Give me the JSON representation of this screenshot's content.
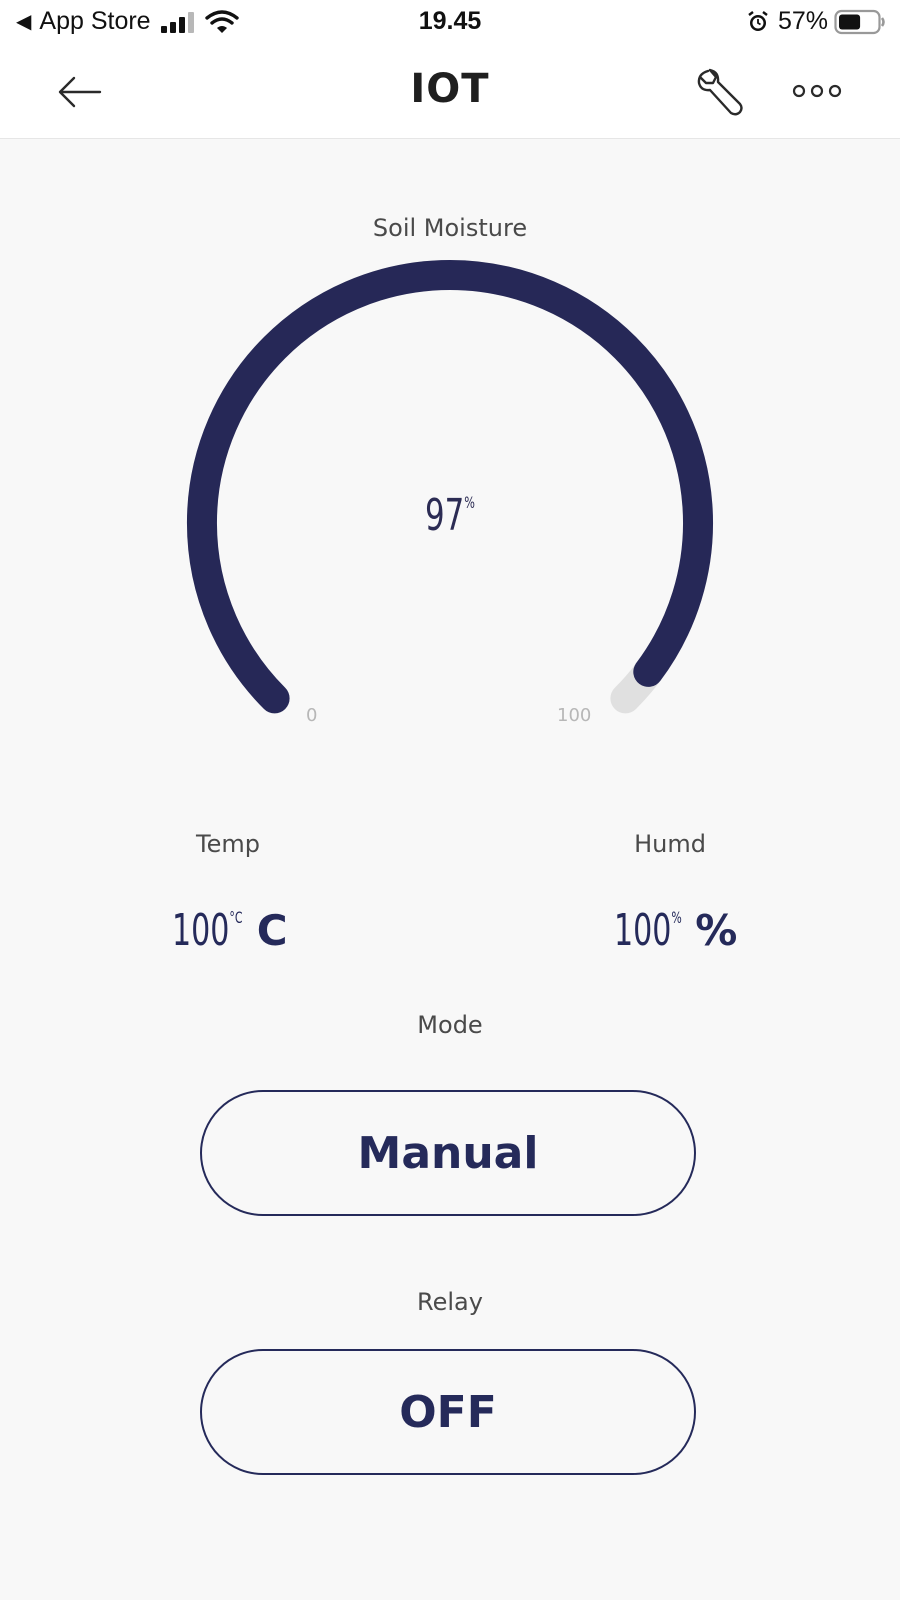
{
  "status_bar": {
    "back_app": "App Store",
    "time": "19.45",
    "battery_percent": "57%",
    "battery_level": 0.57,
    "signal_bars": 3
  },
  "nav": {
    "title": "IOT",
    "back_icon": "arrow-left-icon",
    "settings_icon": "wrench-icon",
    "more_icon": "more-dots-icon"
  },
  "gauge": {
    "label": "Soil Moisture",
    "value": "97",
    "value_unit": "%",
    "value_num": 97,
    "min": "0",
    "max": "100",
    "min_num": 0,
    "max_num": 100,
    "fill_color": "#262857",
    "track_color": "#e0e0e0"
  },
  "temp": {
    "label": "Temp",
    "value": "100",
    "value_unit": "°C",
    "unit": "C"
  },
  "humd": {
    "label": "Humd",
    "value": "100",
    "value_unit": "%",
    "unit": "%"
  },
  "mode": {
    "label": "Mode",
    "button": "Manual"
  },
  "relay": {
    "label": "Relay",
    "button": "OFF"
  },
  "colors": {
    "accent": "#252a5a",
    "background": "#f8f8f8"
  }
}
